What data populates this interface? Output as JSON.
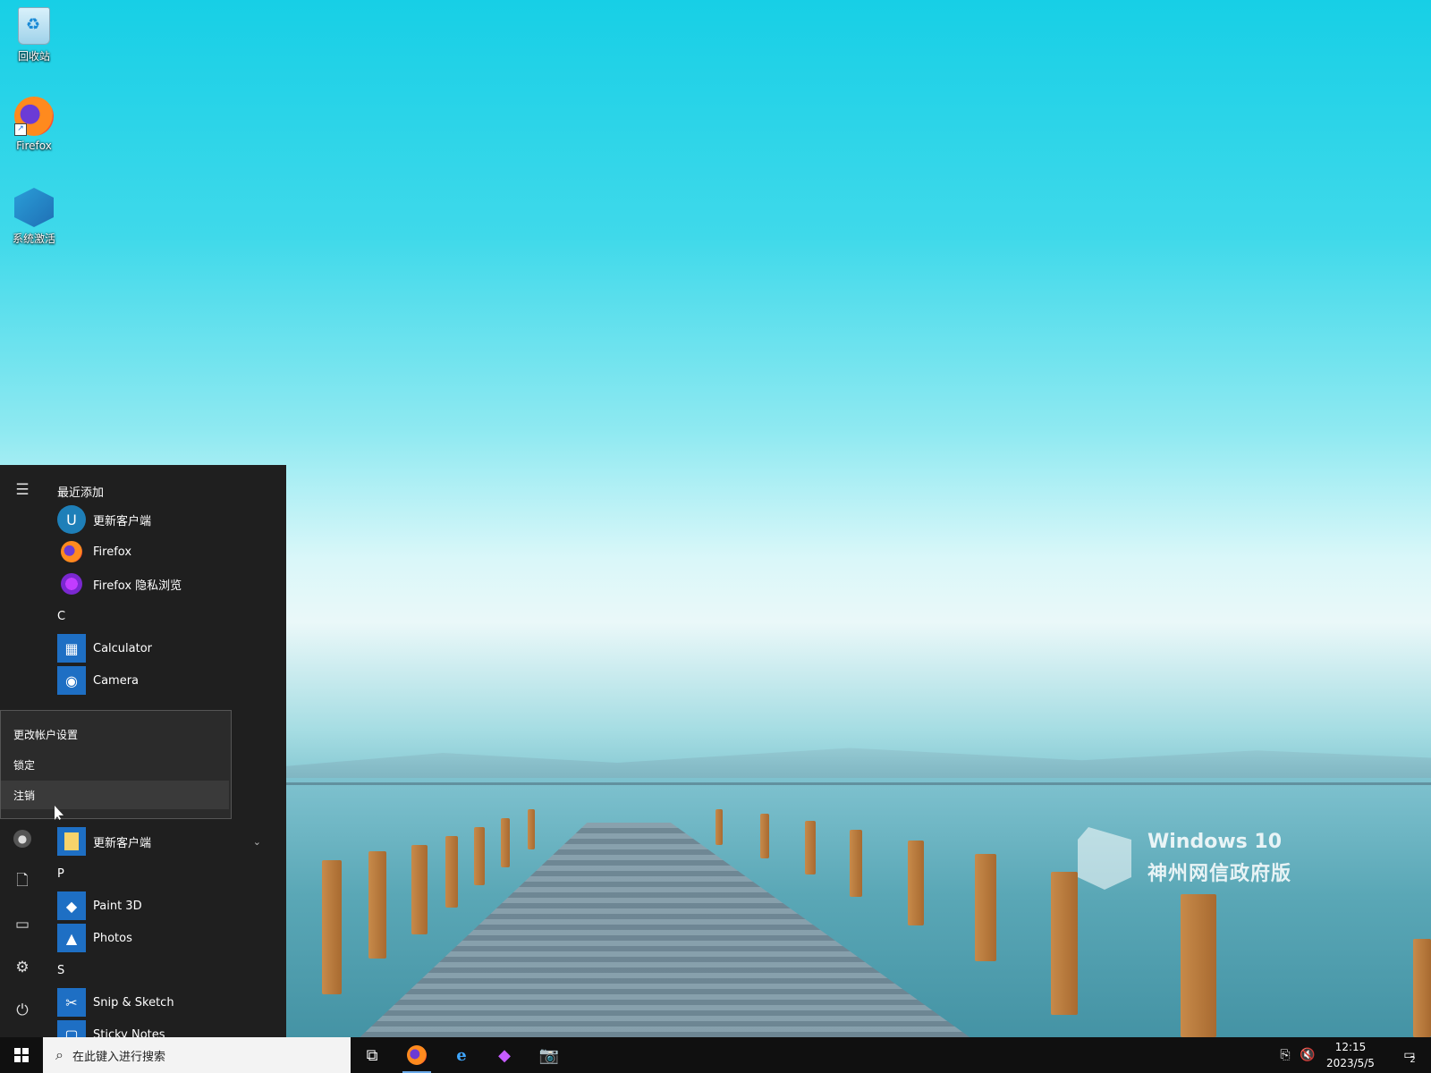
{
  "desktop": {
    "icons": [
      {
        "label": "回收站",
        "icon": "recycle-bin-icon"
      },
      {
        "label": "Firefox",
        "icon": "firefox-icon"
      },
      {
        "label": "系统激活",
        "icon": "activation-icon"
      }
    ],
    "watermark": {
      "line1": "Windows 10",
      "line2": "神州网信政府版"
    }
  },
  "start_menu": {
    "rail": [
      "menu-icon",
      "user-avatar-icon",
      "documents-icon",
      "pictures-icon",
      "settings-icon",
      "power-icon"
    ],
    "recent_header": "最近添加",
    "recent": [
      {
        "label": "更新客户端",
        "icon": "update-client-icon",
        "icon_text": "U",
        "color": "#1e7fb8"
      },
      {
        "label": "Firefox",
        "icon": "firefox-icon"
      },
      {
        "label": "Firefox 隐私浏览",
        "icon": "firefox-private-icon"
      }
    ],
    "group_c": "C",
    "c_apps": [
      {
        "label": "Calculator",
        "icon": "calculator-icon",
        "color": "#1e6fc4"
      },
      {
        "label": "Camera",
        "icon": "camera-icon",
        "color": "#1e6fc4"
      }
    ],
    "folder": {
      "label": "更新客户端",
      "icon": "folder-icon",
      "chevron": "chevron-down-icon"
    },
    "group_p": "P",
    "p_apps": [
      {
        "label": "Paint 3D",
        "icon": "paint3d-icon",
        "color": "#1e6fc4"
      },
      {
        "label": "Photos",
        "icon": "photos-icon",
        "color": "#1e6fc4"
      }
    ],
    "group_s": "S",
    "s_apps": [
      {
        "label": "Snip & Sketch",
        "icon": "snip-sketch-icon",
        "color": "#1e6fc4"
      },
      {
        "label": "Sticky Notes",
        "icon": "sticky-notes-icon",
        "color": "#1e6fc4"
      }
    ]
  },
  "account_menu": {
    "items": [
      "更改帐户设置",
      "锁定",
      "注销"
    ],
    "hovered": "注销"
  },
  "taskbar": {
    "search_placeholder": "在此键入进行搜索",
    "pinned": [
      "task-view-icon",
      "firefox-icon",
      "ie-icon",
      "paint3d-icon",
      "camera-icon"
    ],
    "tray": [
      "network-icon",
      "volume-muted-icon"
    ],
    "time": "12:15",
    "date": "2023/5/5",
    "notification_count": "2"
  },
  "colors": {
    "accent": "#0078d7",
    "start_bg": "#1f1f1f",
    "taskbar_bg": "#101010"
  }
}
